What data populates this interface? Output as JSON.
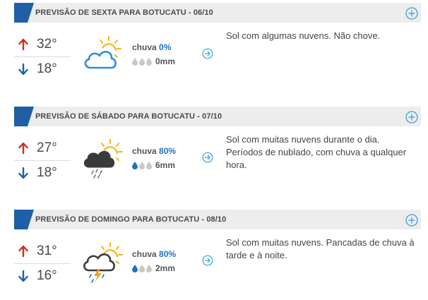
{
  "forecasts": [
    {
      "title": "PREVISÃO DE SEXTA PARA BOTUCATU - 06/10",
      "max_temp": "32°",
      "min_temp": "18°",
      "weather_icon": "partly-cloudy-icon",
      "rain_label": "chuva",
      "rain_pct": "0%",
      "rain_level": 0,
      "rain_mm": "0mm",
      "description": "Sol com algumas nuvens. Não chove."
    },
    {
      "title": "PREVISÃO DE SÁBADO PARA BOTUCATU - 07/10",
      "max_temp": "27°",
      "min_temp": "18°",
      "weather_icon": "sun-cloud-rain-icon",
      "rain_label": "chuva",
      "rain_pct": "80%",
      "rain_level": 1,
      "rain_mm": "6mm",
      "description": "Sol com muitas nuvens durante o dia. Períodos de nublado, com chuva a qualquer hora."
    },
    {
      "title": "PREVISÃO DE DOMINGO PARA BOTUCATU - 08/10",
      "max_temp": "31°",
      "min_temp": "16°",
      "weather_icon": "sun-cloud-storm-icon",
      "rain_label": "chuva",
      "rain_pct": "80%",
      "rain_level": 1,
      "rain_mm": "2mm",
      "description": "Sol com muitas nuvens. Pancadas de chuva à tarde e à noite."
    }
  ],
  "colors": {
    "accent_blue": "#1e73be",
    "max_arrow_red": "#d42a1f",
    "min_arrow_blue": "#1e5fa8",
    "header_bg": "#ededed",
    "sun_yellow": "#f6b51b",
    "plus_icon_teal": "#3ba0d8"
  },
  "icons": {
    "max": "arrow-up-icon",
    "min": "arrow-down-icon",
    "expand": "plus-circle-icon",
    "details": "arrow-right-circle-icon",
    "drop": "raindrop-icon"
  }
}
